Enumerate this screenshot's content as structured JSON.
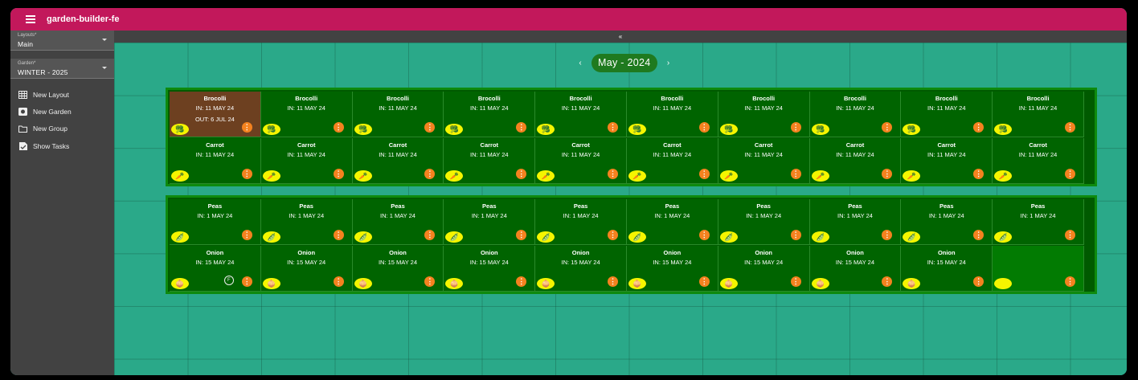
{
  "app": {
    "title": "garden-builder-fe"
  },
  "sidebar": {
    "layouts_select": {
      "label": "Layouts*",
      "value": "Main"
    },
    "garden_select": {
      "label": "Garden*",
      "value": "WINTER - 2025"
    },
    "items": [
      {
        "label": "New Layout",
        "icon": "grid-icon"
      },
      {
        "label": "New Garden",
        "icon": "garden-icon"
      },
      {
        "label": "New Group",
        "icon": "folder-icon"
      },
      {
        "label": "Show Tasks",
        "icon": "tasks-icon"
      }
    ]
  },
  "collapse": {
    "label": "«"
  },
  "calendar": {
    "month": "May - 2024",
    "prev": "‹",
    "next": "›"
  },
  "groups": [
    {
      "rows": [
        {
          "crop": "Brocolli",
          "icon": "broccoli-icon",
          "glyph": "🥦",
          "cells": [
            {
              "name": "Brocolli",
              "in": "IN: 11 MAY 24",
              "out": "OUT: 6 JUL 24",
              "harvested": true
            },
            {
              "name": "Brocolli",
              "in": "IN: 11 MAY 24"
            },
            {
              "name": "Brocolli",
              "in": "IN: 11 MAY 24"
            },
            {
              "name": "Brocolli",
              "in": "IN: 11 MAY 24"
            },
            {
              "name": "Brocolli",
              "in": "IN: 11 MAY 24"
            },
            {
              "name": "Brocolli",
              "in": "IN: 11 MAY 24"
            },
            {
              "name": "Brocolli",
              "in": "IN: 11 MAY 24"
            },
            {
              "name": "Brocolli",
              "in": "IN: 11 MAY 24"
            },
            {
              "name": "Brocolli",
              "in": "IN: 11 MAY 24"
            },
            {
              "name": "Brocolli",
              "in": "IN: 11 MAY 24"
            }
          ]
        },
        {
          "crop": "Carrot",
          "icon": "carrot-icon",
          "glyph": "🥕",
          "cells": [
            {
              "name": "Carrot",
              "in": "IN: 11 MAY 24"
            },
            {
              "name": "Carrot",
              "in": "IN: 11 MAY 24"
            },
            {
              "name": "Carrot",
              "in": "IN: 11 MAY 24"
            },
            {
              "name": "Carrot",
              "in": "IN: 11 MAY 24"
            },
            {
              "name": "Carrot",
              "in": "IN: 11 MAY 24"
            },
            {
              "name": "Carrot",
              "in": "IN: 11 MAY 24"
            },
            {
              "name": "Carrot",
              "in": "IN: 11 MAY 24"
            },
            {
              "name": "Carrot",
              "in": "IN: 11 MAY 24"
            },
            {
              "name": "Carrot",
              "in": "IN: 11 MAY 24"
            },
            {
              "name": "Carrot",
              "in": "IN: 11 MAY 24"
            }
          ]
        }
      ]
    },
    {
      "rows": [
        {
          "crop": "Peas",
          "icon": "peas-icon",
          "glyph": "🫛",
          "cells": [
            {
              "name": "Peas",
              "in": "IN: 1 MAY 24"
            },
            {
              "name": "Peas",
              "in": "IN: 1 MAY 24"
            },
            {
              "name": "Peas",
              "in": "IN: 1 MAY 24"
            },
            {
              "name": "Peas",
              "in": "IN: 1 MAY 24"
            },
            {
              "name": "Peas",
              "in": "IN: 1 MAY 24"
            },
            {
              "name": "Peas",
              "in": "IN: 1 MAY 24"
            },
            {
              "name": "Peas",
              "in": "IN: 1 MAY 24"
            },
            {
              "name": "Peas",
              "in": "IN: 1 MAY 24"
            },
            {
              "name": "Peas",
              "in": "IN: 1 MAY 24"
            },
            {
              "name": "Peas",
              "in": "IN: 1 MAY 24"
            }
          ]
        },
        {
          "crop": "Onion",
          "icon": "onion-icon",
          "glyph": "🧅",
          "cells": [
            {
              "name": "Onion",
              "in": "IN: 15 MAY 24",
              "flag": "F"
            },
            {
              "name": "Onion",
              "in": "IN: 15 MAY 24"
            },
            {
              "name": "Onion",
              "in": "IN: 15 MAY 24"
            },
            {
              "name": "Onion",
              "in": "IN: 15 MAY 24"
            },
            {
              "name": "Onion",
              "in": "IN: 15 MAY 24"
            },
            {
              "name": "Onion",
              "in": "IN: 15 MAY 24"
            },
            {
              "name": "Onion",
              "in": "IN: 15 MAY 24"
            },
            {
              "name": "Onion",
              "in": "IN: 15 MAY 24"
            },
            {
              "name": "Onion",
              "in": "IN: 15 MAY 24"
            },
            {
              "name": "",
              "in": "",
              "empty": true
            }
          ]
        }
      ]
    }
  ],
  "cell_menu": {
    "glyph": "⋮"
  },
  "colors": {
    "topbar": "#c2185b",
    "sidebar": "#424242",
    "canvas": "#2aa989",
    "group_border": "#0e8a0e",
    "cell": "#006400",
    "harvested": "#6d4020",
    "badge": "#f5f500",
    "menu_button": "#f4821f"
  }
}
